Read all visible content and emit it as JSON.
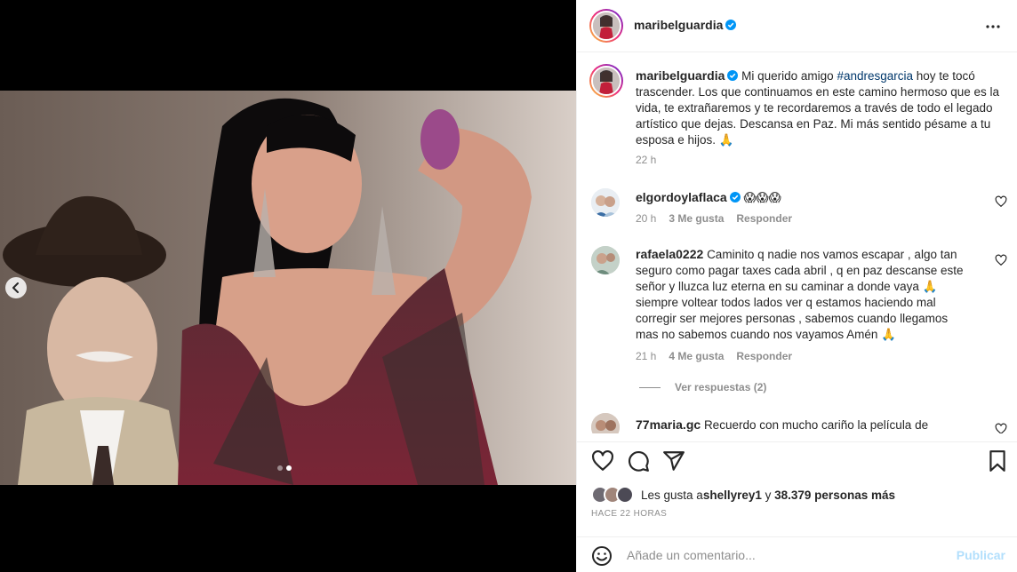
{
  "post": {
    "author": "maribelguardia",
    "verified": true,
    "more_icon": "more-horizontal-icon"
  },
  "caption": {
    "username": "maribelguardia",
    "text_before": "Mi querido amigo ",
    "hashtag": "#andresgarcia",
    "text_after": " hoy te tocó trascender. Los que continuamos en este camino hermoso que es la vida, te extrañaremos y te recordaremos a través de todo el legado artístico que dejas. Descansa en Paz. Mi más sentido pésame a tu esposa e hijos. 🙏",
    "time": "22 h"
  },
  "comments": [
    {
      "username": "elgordoylaflaca",
      "verified": true,
      "text": "😱😱😱",
      "time": "20 h",
      "likes": "3 Me gusta",
      "reply": "Responder"
    },
    {
      "username": "rafaela0222",
      "verified": false,
      "text": "Caminito q nadie nos vamos escapar , algo tan seguro como pagar taxes cada abril , q en paz descanse este señor y lluzca luz eterna en su caminar a donde vaya 🙏 siempre voltear todos lados ver q estamos haciendo mal corregir ser mejores personas , sabemos cuando llegamos mas no sabemos cuando nos vayamos Amén 🙏",
      "time": "21 h",
      "likes": "4 Me gusta",
      "reply": "Responder",
      "view_replies": "Ver respuestas (2)"
    },
    {
      "username": "77maria.gc",
      "verified": false,
      "text": "Recuerdo con mucho cariño la película de ustedes"
    }
  ],
  "likes": {
    "prefix": "Les gusta a ",
    "user": "shellyrey1",
    "middle": " y ",
    "count": "38.379 personas más"
  },
  "time_ago": "Hace 22 horas",
  "add_comment": {
    "placeholder": "Añade un comentario...",
    "publish": "Publicar"
  },
  "carousel": {
    "total_slides": 2,
    "active_slide": 2
  },
  "colors": {
    "verified": "#0095f6",
    "publish_disabled": "#b2dffc",
    "hashtag": "#00376b",
    "meta": "#8e8e8e"
  }
}
